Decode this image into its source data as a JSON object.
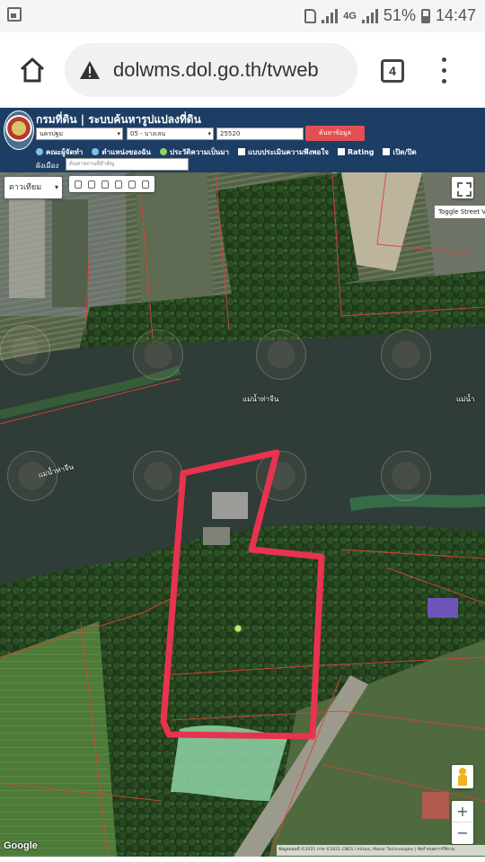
{
  "status_bar": {
    "network_label": "4G",
    "battery_percent": "51%",
    "time": "14:47"
  },
  "browser": {
    "url": "dolwms.dol.go.th/tvweb",
    "tab_count": "4"
  },
  "site": {
    "title": "กรมที่ดิน | ระบบค้นหารูปแปลงที่ดิน",
    "province_select": "นครปฐม",
    "district_select": "05 - บางเลน",
    "parcel_number": "25520",
    "search_button": "ค้นหาข้อมูล",
    "nav": {
      "officials": "คณะผู้จัดทำ",
      "my_location": "ตำแหน่งของฉัน",
      "history": "ประวัติความเป็นมา",
      "survey": "แบบประเมินความพึงพอใจ",
      "rating": "Rating",
      "toggle": "เปิด/ปิด",
      "overlay_label": "ผังเมือง"
    },
    "address_placeholder": "ค้นหาสถานที่สำคัญ"
  },
  "map": {
    "map_type": "ดาวเทียม",
    "toggle_street": "Toggle Street View",
    "river_labels": [
      "แม่น้ำท่าจีน",
      "แม่น้ำท่าจีน",
      "แม่น้ำ"
    ],
    "zoom_in": "+",
    "zoom_out": "−",
    "google_logo": "Google",
    "attribution": "ข้อมูลแผนที่ ©2021 ภาพ ©2021 CNES / Airbus, Maxar Technologies | ข้อกำหนดการใช้งาน"
  },
  "colors": {
    "header_bg": "#1c3d64",
    "search_button": "#e15151",
    "plot_outline": "#e8334f",
    "parcel_lines": "#d9443a"
  }
}
